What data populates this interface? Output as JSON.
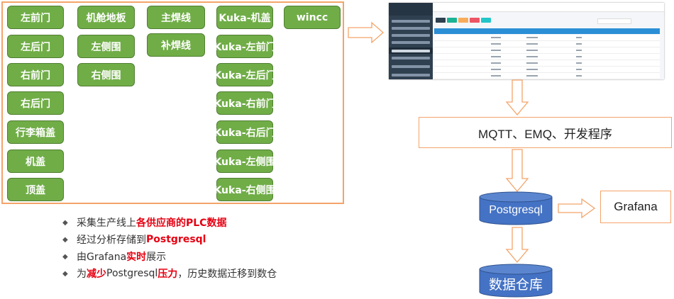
{
  "plc_sources": {
    "col1": [
      "左前门",
      "左后门",
      "右前门",
      "右后门",
      "行李箱盖",
      "机盖",
      "顶盖"
    ],
    "col2": [
      "机舱地板",
      "左侧围",
      "右侧围"
    ],
    "col3": [
      "主焊线",
      "补焊线"
    ],
    "col4": [
      "Kuka-机盖",
      "Kuka-左前门",
      "Kuka-左后门",
      "Kuka-右前门",
      "Kuka-右后门",
      "Kuka-左侧围",
      "Kuka-右侧围"
    ],
    "col5": [
      "wincc"
    ]
  },
  "flow": {
    "middleware": "MQTT、EMQ、开发程序",
    "database": "Postgresql",
    "dashboard": "Grafana",
    "warehouse": "数据仓库"
  },
  "bullets": [
    {
      "parts": [
        {
          "t": "采集生产线上",
          "hl": false
        },
        {
          "t": "各供应商的PLC数据",
          "hl": true
        }
      ]
    },
    {
      "parts": [
        {
          "t": "经过分析存储到",
          "hl": false
        },
        {
          "t": "Postgresql",
          "hl": true
        }
      ]
    },
    {
      "parts": [
        {
          "t": "由Grafana",
          "hl": false
        },
        {
          "t": "实时",
          "hl": true
        },
        {
          "t": "展示",
          "hl": false
        }
      ]
    },
    {
      "parts": [
        {
          "t": "为",
          "hl": false
        },
        {
          "t": "减少",
          "hl": true
        },
        {
          "t": "Postgresql",
          "hl": false
        },
        {
          "t": "压力",
          "hl": true
        },
        {
          "t": "，历史数据迁移到数仓",
          "hl": false
        }
      ]
    }
  ],
  "colors": {
    "button_green": "#70ad47",
    "border_orange": "#f4a46a",
    "cylinder_blue": "#4472c4",
    "highlight_red": "#e60012"
  },
  "icons": {
    "bullet": "diamond-bullet-icon",
    "arrow": "block-arrow-icon"
  }
}
